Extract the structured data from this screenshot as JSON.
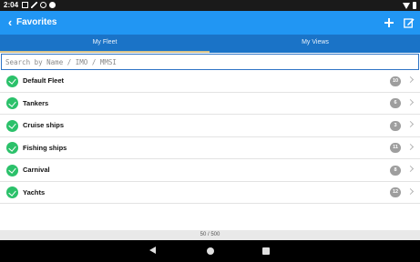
{
  "status_bar": {
    "time": "2:04"
  },
  "app_bar": {
    "title": "Favorites",
    "icons": {
      "back": "back-arrow-icon",
      "add": "plus-icon",
      "edit": "edit-icon"
    },
    "color": "#2196f3"
  },
  "tabs": [
    {
      "label": "My Fleet",
      "selected": true
    },
    {
      "label": "My Views",
      "selected": false
    }
  ],
  "search": {
    "placeholder": "Search by Name / IMO / MMSI",
    "value": ""
  },
  "fleets": [
    {
      "name": "Default Fleet",
      "count": "10"
    },
    {
      "name": "Tankers",
      "count": "6"
    },
    {
      "name": "Cruise ships",
      "count": "3"
    },
    {
      "name": "Fishing ships",
      "count": "11"
    },
    {
      "name": "Carnival",
      "count": "8"
    },
    {
      "name": "Yachts",
      "count": "12"
    }
  ],
  "footer": {
    "count_text": "50 / 500"
  },
  "colors": {
    "accent": "#2196f3",
    "tab_bar": "#1a73c7",
    "check": "#2bc16a",
    "badge": "#9e9e9e"
  }
}
